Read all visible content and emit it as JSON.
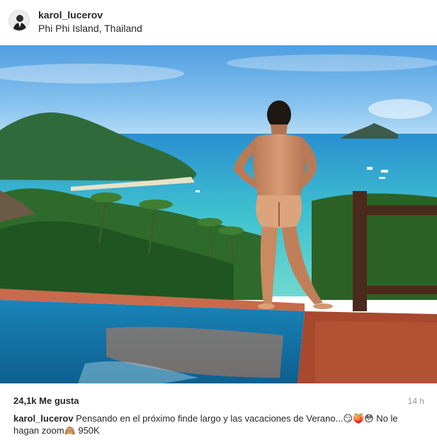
{
  "post": {
    "username": "karol_lucerov",
    "location": "Phi Phi Island, Thailand",
    "likes": "24,1k Me gusta",
    "time": "14 h",
    "caption_user": "karol_lucerov",
    "caption_text": "Pensando en el próximo finde largo y las vacaciones de Verano...😏🍑😳 No le hagan zoom🙈 950K"
  }
}
